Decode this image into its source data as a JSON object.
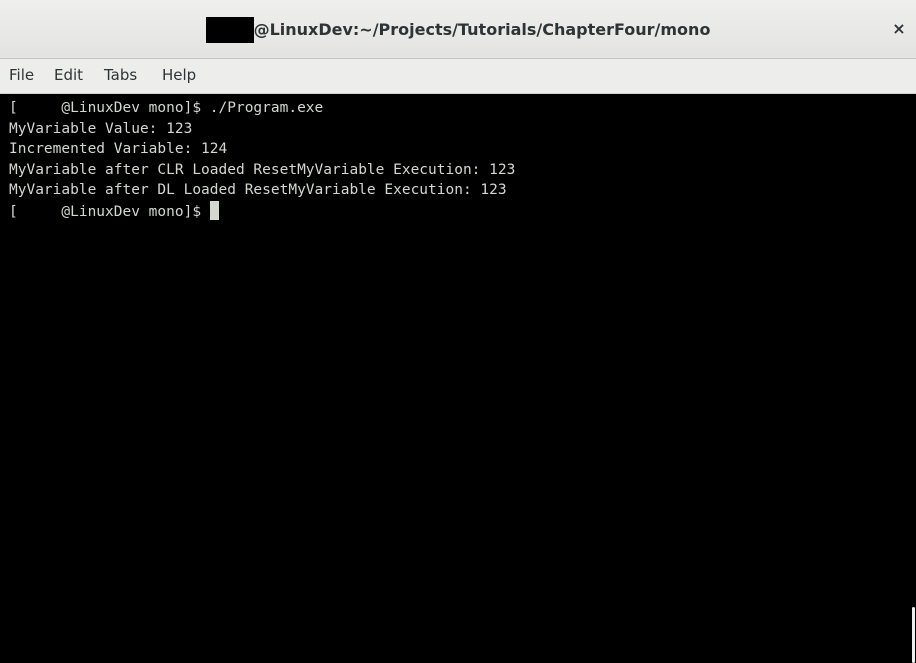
{
  "window": {
    "title": "@LinuxDev:~/Projects/Tutorials/ChapterFour/mono",
    "close_label": "×"
  },
  "menu": {
    "items": [
      {
        "label": "File"
      },
      {
        "label": "Edit"
      },
      {
        "label": "Tabs"
      },
      {
        "label": "Help"
      }
    ]
  },
  "terminal": {
    "lines": [
      "[     @LinuxDev mono]$ ./Program.exe",
      "MyVariable Value: 123",
      "Incremented Variable: 124",
      "MyVariable after CLR Loaded ResetMyVariable Execution: 123",
      "MyVariable after DL Loaded ResetMyVariable Execution: 123"
    ],
    "prompt": "[     @LinuxDev mono]$ "
  },
  "colors": {
    "terminal_bg": "#000000",
    "terminal_fg": "#d3d7cf",
    "chrome_bg": "#ededeb",
    "chrome_text": "#2e3436"
  }
}
